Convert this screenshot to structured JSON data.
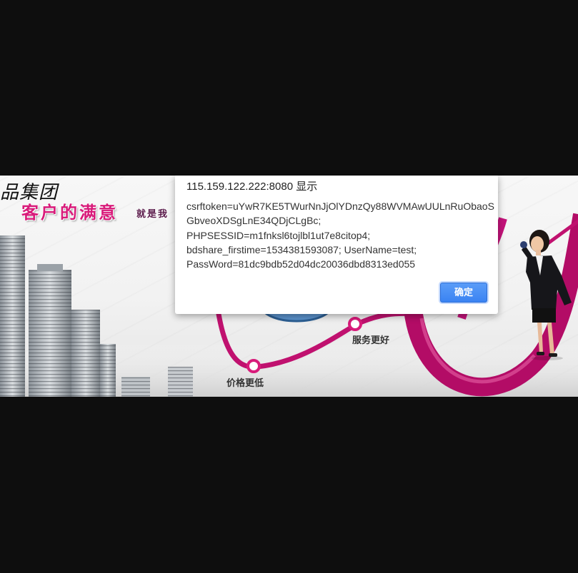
{
  "dialog": {
    "title": "115.159.122.222:8080 显示",
    "lines": [
      "csrftoken=uYwR7KE5TWurNnJjOlYDnzQy88WVMAwUULnRuObaoS",
      "GbveoXDSgLnE34QDjCLgBc;",
      "PHPSESSID=m1fnksl6tojlbl1ut7e8citop4;",
      "bdshare_firstime=1534381593087; UserName=test;",
      "PassWord=81dc9bdb52d04dc20036dbd8313ed055"
    ],
    "ok_label": "确定"
  },
  "banner": {
    "company_partial": "品集团",
    "slogan": "客户的满意",
    "slogan_tail": "就是我",
    "node_labels": {
      "service": "服务更好",
      "price": "价格更低"
    }
  },
  "colors": {
    "letterbox": "#0e0e0e",
    "button_blue": "#3a83f2",
    "ribbon_magenta": "#c0116f",
    "slogan_pink": "#d81b7a"
  }
}
